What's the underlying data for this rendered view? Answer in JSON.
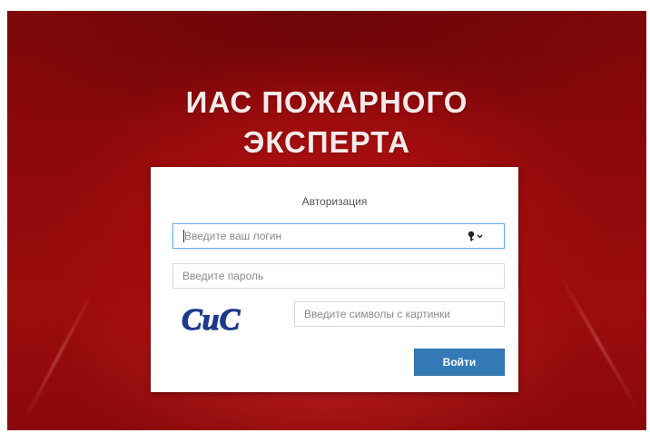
{
  "header": {
    "title_line1": "ИАС ПОЖАРНОГО",
    "title_line2": "ЭКСПЕРТА"
  },
  "login_card": {
    "title": "Авторизация",
    "login": {
      "placeholder": "Введите ваш логин",
      "value": "",
      "icon": "key-icon"
    },
    "password": {
      "placeholder": "Введите пароль",
      "value": ""
    },
    "captcha": {
      "image_text": "CuC",
      "placeholder": "Введите символы с картинки",
      "value": ""
    },
    "submit_label": "Войти"
  },
  "colors": {
    "background": "#9c0c0d",
    "title_text": "#f6eaea",
    "primary_button": "#337ab7",
    "focus_border": "#66afe9",
    "captcha_text": "#1d3a8c"
  }
}
